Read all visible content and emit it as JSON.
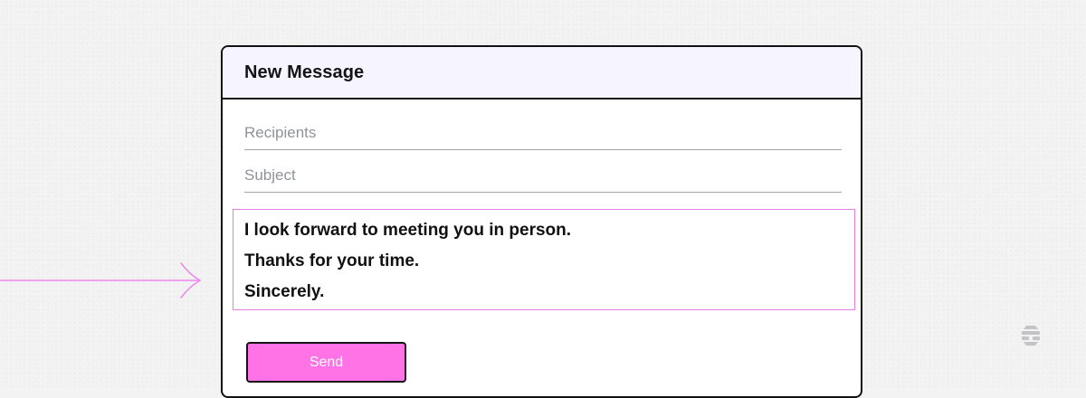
{
  "compose": {
    "title": "New Message",
    "recipients": {
      "value": "",
      "placeholder": "Recipients"
    },
    "subject": {
      "value": "",
      "placeholder": "Subject"
    },
    "body_lines": [
      "I look forward to meeting you in person.",
      "Thanks for your time.",
      "Sincerely."
    ],
    "send_label": "Send"
  },
  "icons": {
    "pointer": "arrow-right-icon",
    "logo": "hive-logo-icon"
  },
  "colors": {
    "accent_pink": "#ff73e6",
    "body_border": "#e37fe4",
    "arrow": "#ee86ee",
    "header_bg": "#f6f4ff",
    "outline": "#121212",
    "placeholder": "#8f9399",
    "logo": "#c4c4c8"
  }
}
